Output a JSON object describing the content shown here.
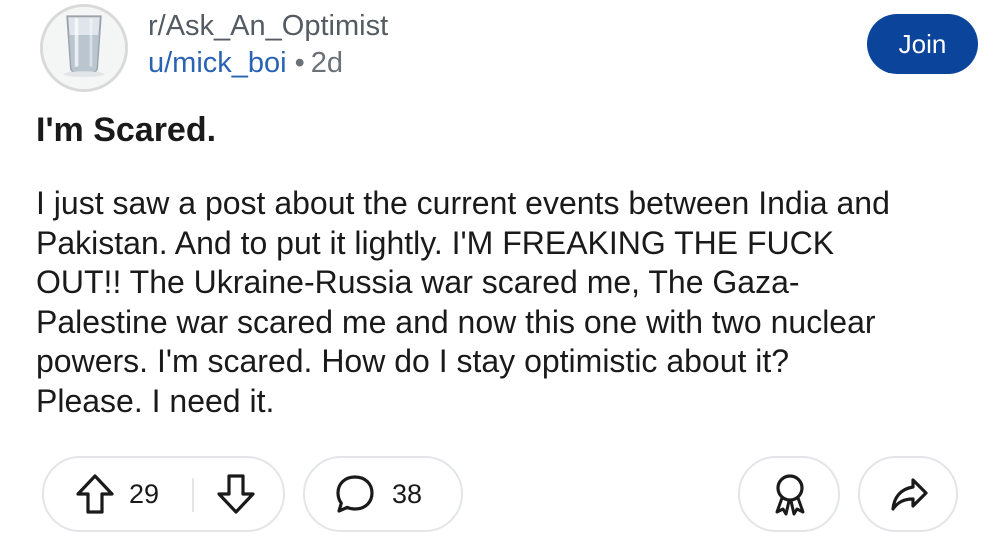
{
  "header": {
    "avatar_icon": "water-glass-icon",
    "subreddit": "r/Ask_An_Optimist",
    "username": "u/mick_boi",
    "separator": "•",
    "age": "2d",
    "join_label": "Join"
  },
  "post": {
    "title": "I'm Scared.",
    "body_lines": [
      "I just saw a post about the current events between India and",
      "Pakistan. And to put it lightly. I'M FREAKING THE FUCK",
      "OUT!! The Ukraine-Russia war scared me, The Gaza-",
      "Palestine war scared me and now this one with two nuclear",
      "powers. I'm scared. How do I stay optimistic about it?",
      "Please. I need it."
    ]
  },
  "actions": {
    "upvote_icon": "upvote-arrow-icon",
    "downvote_icon": "downvote-arrow-icon",
    "vote_count": "29",
    "comment_icon": "comment-bubble-icon",
    "comment_count": "38",
    "award_icon": "award-icon",
    "share_icon": "share-arrow-icon"
  },
  "colors": {
    "join_button": "#0a449b",
    "username_link": "#2a63b4",
    "muted_text": "#6b7178",
    "pill_border": "#e3e5e8"
  }
}
